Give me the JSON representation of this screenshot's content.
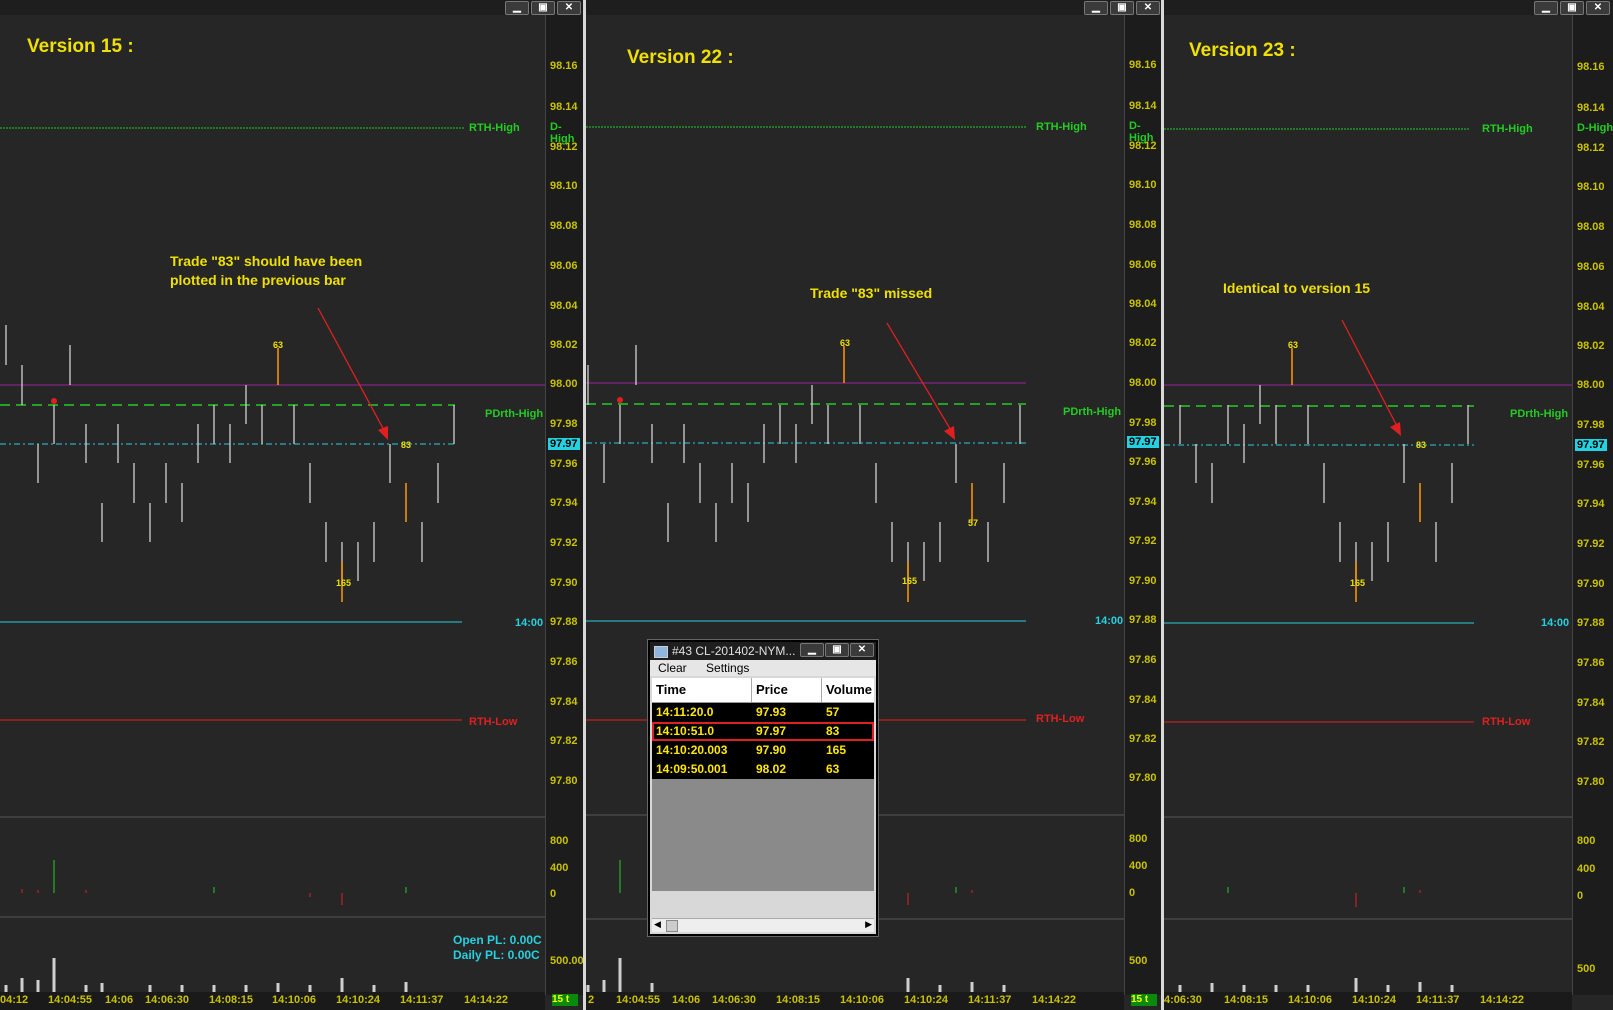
{
  "panes": [
    {
      "title": "Version 15 :",
      "annotation": "Trade \"83\" should have been\nplotted in the previous bar",
      "labels": {
        "rth_high": "RTH-High",
        "d_high": "D-High",
        "pdrth_high": "PDrth-High",
        "t1400": "14:00",
        "rth_low": "RTH-Low"
      },
      "pl": {
        "open": "Open PL: 0.00C",
        "daily": "Daily PL: 0.00C"
      },
      "vol_ticks": [
        "800",
        "400",
        "0"
      ],
      "bottom_tick": "500.00",
      "time_labels": [
        "04:12",
        "14:04:55",
        "14:06",
        "14:06:30",
        "14:08:15",
        "14:10:06",
        "14:10:24",
        "14:11:37",
        "14:14:22"
      ],
      "trade_labels": [
        "63",
        "83",
        "165"
      ]
    },
    {
      "title": "Version 22 :",
      "annotation": "Trade \"83\" missed",
      "labels": {
        "rth_high": "RTH-High",
        "d_high": "D-High",
        "pdrth_high": "PDrth-High",
        "t1400": "14:00",
        "rth_low": "RTH-Low"
      },
      "vol_ticks": [
        "800",
        "400",
        "0"
      ],
      "bottom_tick": "500",
      "time_labels": [
        "2",
        "14:04:55",
        "14:06",
        "14:06:30",
        "14:08:15",
        "14:10:06",
        "14:10:24",
        "14:11:37",
        "14:14:22"
      ],
      "trade_labels": [
        "63",
        "57",
        "165"
      ]
    },
    {
      "title": "Version 23 :",
      "annotation": "Identical to version 15",
      "labels": {
        "rth_high": "RTH-High",
        "d_high": "D-High",
        "pdrth_high": "PDrth-High",
        "t1400": "14:00",
        "rth_low": "RTH-Low"
      },
      "vol_ticks": [
        "800",
        "400",
        "0"
      ],
      "bottom_tick": "500",
      "time_labels": [
        "4:06:30",
        "14:08:15",
        "14:10:06",
        "14:10:24",
        "14:11:37",
        "14:14:22"
      ],
      "trade_labels": [
        "63",
        "83",
        "165"
      ]
    }
  ],
  "price_ticks": [
    "98.16",
    "98.14",
    "98.12",
    "98.10",
    "98.08",
    "98.06",
    "98.04",
    "98.02",
    "98.00",
    "97.98",
    "97.96",
    "97.94",
    "97.92",
    "97.90",
    "97.88",
    "97.86",
    "97.84",
    "97.82",
    "97.80"
  ],
  "price_badge": "97.97",
  "interval_badge": "15 t",
  "window_buttons": {
    "minimize": "▁",
    "maximize": "▣",
    "close": "✕"
  },
  "tas_window": {
    "title": "#43 CL-201402-NYM...",
    "menu": [
      "Clear",
      "Settings"
    ],
    "columns": [
      "Time",
      "Price",
      "Volume"
    ],
    "rows": [
      {
        "time": "14:11:20.0",
        "price": "97.93",
        "volume": "57"
      },
      {
        "time": "14:10:51.0",
        "price": "97.97",
        "volume": "83"
      },
      {
        "time": "14:10:20.003",
        "price": "97.90",
        "volume": "165"
      },
      {
        "time": "14:09:50.001",
        "price": "98.02",
        "volume": "63"
      }
    ]
  },
  "colors": {
    "yellow": "#f0e000",
    "green": "#22cc22",
    "red": "#e02020",
    "cyan": "#25d0e0",
    "magenta": "#b020b0"
  }
}
